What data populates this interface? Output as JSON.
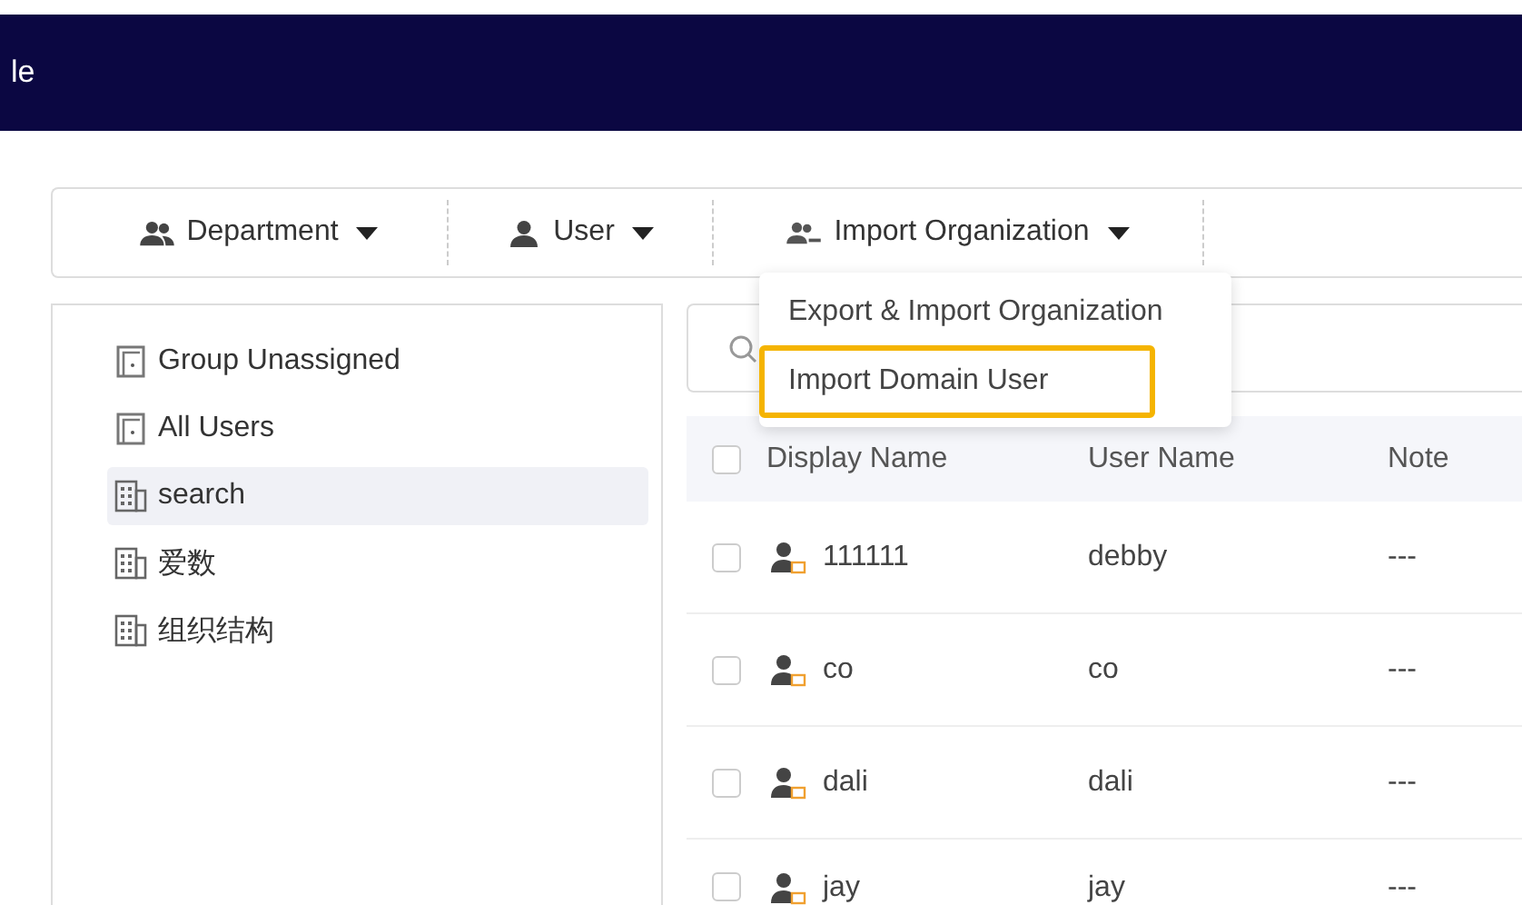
{
  "header": {
    "title": "le"
  },
  "toolbar": [
    {
      "label": "Department",
      "kind": "group"
    },
    {
      "label": "User",
      "kind": "user"
    },
    {
      "label": "Import Organization",
      "kind": "import"
    }
  ],
  "dropdown": [
    {
      "label": "Export & Import Organization",
      "selected": false
    },
    {
      "label": "Import Domain User",
      "selected": true
    }
  ],
  "tree": [
    {
      "label": "Group Unassigned",
      "kind": "folder",
      "selected": false
    },
    {
      "label": "All Users",
      "kind": "folder",
      "selected": false
    },
    {
      "label": "search",
      "kind": "building",
      "selected": true
    },
    {
      "label": "爱数",
      "kind": "building",
      "selected": false
    },
    {
      "label": "组织结构",
      "kind": "building",
      "selected": false
    }
  ],
  "table": {
    "header_checked": false,
    "columns": [
      "Display Name",
      "User Name",
      "Note"
    ],
    "rows": [
      {
        "checked": false,
        "display_name": "111111",
        "user_name": "debby",
        "note": "---"
      },
      {
        "checked": false,
        "display_name": "co",
        "user_name": "co",
        "note": "---"
      },
      {
        "checked": false,
        "display_name": "dali",
        "user_name": "dali",
        "note": "---"
      },
      {
        "checked": false,
        "display_name": "jay",
        "user_name": "jay",
        "note": "---"
      }
    ]
  }
}
